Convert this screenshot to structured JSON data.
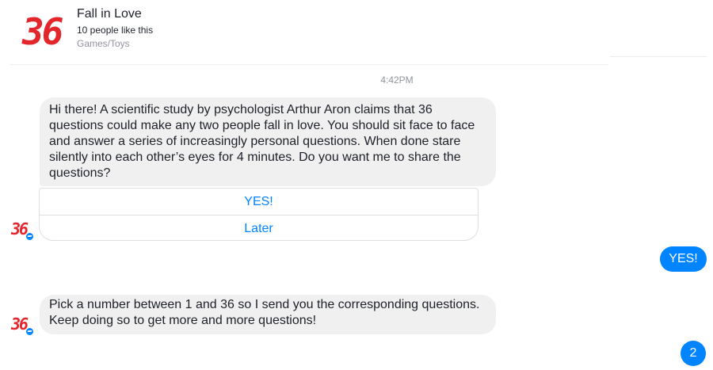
{
  "header": {
    "logo_text": "36",
    "page_name": "Fall in Love",
    "likes": "10 people like this",
    "category": "Games/Toys"
  },
  "conversation": {
    "timestamp": "4:42PM",
    "messages": [
      {
        "sender": "bot",
        "text": "Hi there! A scientific study by psychologist Arthur Aron claims that 36 questions could make any two people fall in love. You should sit face to face and answer a series of increasingly personal questions. When done stare silently into each other’s eyes for 4 minutes. Do you want me to share the questions?",
        "quick_replies": [
          "YES!",
          "Later"
        ]
      },
      {
        "sender": "user",
        "text": "YES!"
      },
      {
        "sender": "bot",
        "text": "Pick a number between 1 and 36 so I send you the corresponding questions. Keep doing so to get more and more questions!"
      }
    ],
    "avatar_text": "36"
  },
  "unread_count": "2",
  "colors": {
    "accent": "#0084ff",
    "logo_red": "#e3262b",
    "bubble_gray": "#f1f0f0",
    "meta_gray": "#90949c"
  }
}
